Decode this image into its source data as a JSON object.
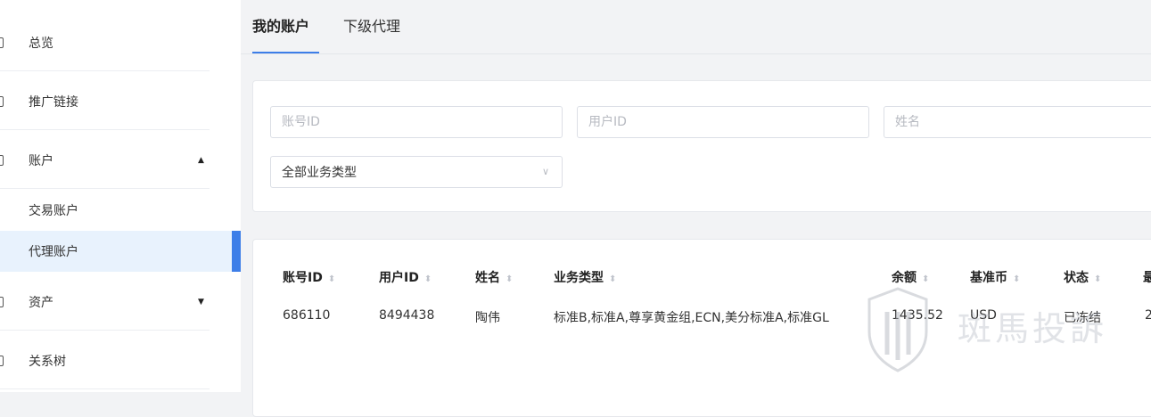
{
  "sidebar": {
    "items": [
      {
        "label": "总览"
      },
      {
        "label": "推广链接"
      },
      {
        "label": "账户"
      },
      {
        "label": "交易账户"
      },
      {
        "label": "代理账户"
      },
      {
        "label": "资产"
      },
      {
        "label": "关系树"
      }
    ],
    "arrows": {
      "account": "▲",
      "assets": "▼"
    }
  },
  "tabs": [
    {
      "label": "我的账户"
    },
    {
      "label": "下级代理"
    }
  ],
  "filters": {
    "account_id_placeholder": "账号ID",
    "user_id_placeholder": "用户ID",
    "name_placeholder": "姓名",
    "business_type_value": "全部业务类型",
    "chevron": "∨"
  },
  "table": {
    "sort_glyph": "⬍",
    "headers": [
      "账号ID",
      "用户ID",
      "姓名",
      "业务类型",
      "余额",
      "基准币",
      "状态",
      "最"
    ],
    "rows": [
      [
        "686110",
        "8494438",
        "陶伟",
        "标准B,标准A,尊享黄金组,ECN,美分标准A,标准GL",
        "1435.52",
        "USD",
        "已冻结",
        "2"
      ]
    ]
  },
  "watermark": {
    "text": "斑馬投訴"
  },
  "colors": {
    "accent": "#3d7ee8",
    "active_bg": "#e8f2fd",
    "background": "#f2f3f5"
  }
}
